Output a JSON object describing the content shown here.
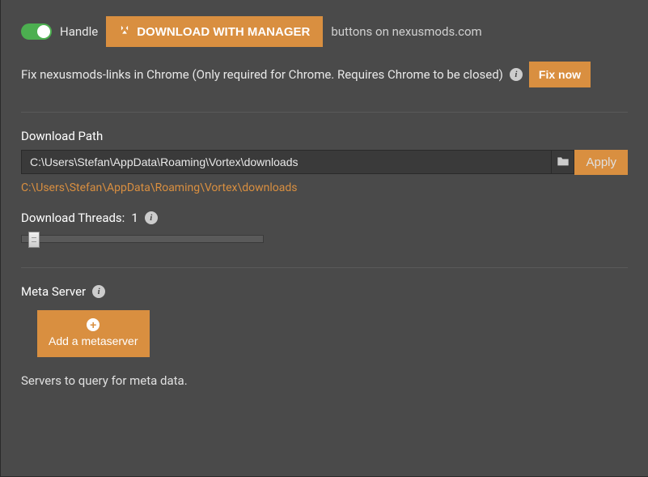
{
  "toggle": {
    "label": "Handle"
  },
  "download_manager": {
    "button": "DOWNLOAD WITH MANAGER",
    "trailing": "buttons on nexusmods.com"
  },
  "chrome": {
    "text": "Fix nexusmods-links in Chrome (Only required for Chrome. Requires Chrome to be closed)",
    "fix_button": "Fix now"
  },
  "download_path": {
    "label": "Download Path",
    "value": "C:\\Users\\Stefan\\AppData\\Roaming\\Vortex\\downloads",
    "apply": "Apply",
    "resolved": "C:\\Users\\Stefan\\AppData\\Roaming\\Vortex\\downloads"
  },
  "download_threads": {
    "label_prefix": "Download Threads: ",
    "value": "1"
  },
  "meta_server": {
    "label": "Meta Server",
    "add_button": "Add a metaserver",
    "description": "Servers to query for meta data."
  }
}
